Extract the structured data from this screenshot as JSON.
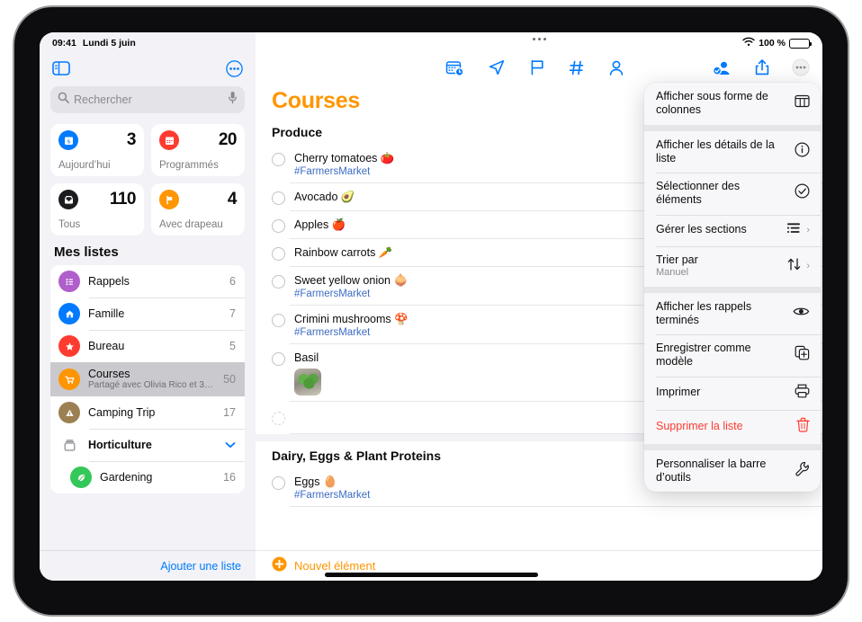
{
  "status_bar": {
    "time": "09:41",
    "date": "Lundi 5 juin",
    "battery_pct": "100 %"
  },
  "sidebar": {
    "toolbar": {
      "sidebar_toggle_icon": "sidebar-toggle-icon",
      "more_icon": "more-circle-icon"
    },
    "search": {
      "placeholder": "Rechercher",
      "value": "",
      "search_icon": "search-icon",
      "mic_icon": "microphone-icon"
    },
    "smart_lists": [
      {
        "label": "Aujourd’hui",
        "count": "3",
        "icon": "today-calendar-icon",
        "color": "#007aff"
      },
      {
        "label": "Programmés",
        "count": "20",
        "icon": "scheduled-calendar-icon",
        "color": "#ff3b30"
      },
      {
        "label": "Tous",
        "count": "110",
        "icon": "all-inbox-icon",
        "color": "#1c1c1e"
      },
      {
        "label": "Avec drapeau",
        "count": "4",
        "icon": "flag-icon",
        "color": "#ff9500"
      }
    ],
    "my_lists_header": "Mes listes",
    "lists": [
      {
        "name": "Rappels",
        "count": "6",
        "icon": "list-bullet-icon",
        "color": "#b05ecb",
        "subtitle": "",
        "selected": false,
        "type": "list"
      },
      {
        "name": "Famille",
        "count": "7",
        "icon": "house-icon",
        "color": "#007aff",
        "subtitle": "",
        "selected": false,
        "type": "list"
      },
      {
        "name": "Bureau",
        "count": "5",
        "icon": "star-icon",
        "color": "#ff3b30",
        "subtitle": "",
        "selected": false,
        "type": "list"
      },
      {
        "name": "Courses",
        "count": "50",
        "icon": "cart-icon",
        "color": "#ff9500",
        "subtitle": "Partagé avec Olivia Rico et 3…",
        "selected": true,
        "type": "list"
      },
      {
        "name": "Camping Trip",
        "count": "17",
        "icon": "triangle-exclamation-icon",
        "color": "#9c8052",
        "subtitle": "",
        "selected": false,
        "type": "list"
      },
      {
        "name": "Horticulture",
        "count": "",
        "icon": "folder-icon",
        "color": "#8e8e93",
        "subtitle": "",
        "selected": false,
        "type": "group"
      },
      {
        "name": "Gardening",
        "count": "16",
        "icon": "leaf-icon",
        "color": "#34c759",
        "subtitle": "",
        "selected": false,
        "type": "list"
      }
    ],
    "add_list_label": "Ajouter une liste"
  },
  "main": {
    "toolbar_icons": [
      {
        "name": "calendar-clock-icon"
      },
      {
        "name": "location-arrow-icon"
      },
      {
        "name": "flag-icon"
      },
      {
        "name": "hashtag-icon"
      },
      {
        "name": "person-icon"
      }
    ],
    "toolbar_right_icons": [
      {
        "name": "add-person-icon"
      },
      {
        "name": "share-icon"
      },
      {
        "name": "more-circle-icon"
      }
    ],
    "title": "Courses",
    "sections": [
      {
        "header": "Produce",
        "items": [
          {
            "title": "Cherry tomatoes 🍅",
            "tag": "#FarmersMarket",
            "photo": false
          },
          {
            "title": "Avocado 🥑",
            "tag": "",
            "photo": false
          },
          {
            "title": "Apples 🍎",
            "tag": "",
            "photo": false
          },
          {
            "title": "Rainbow carrots 🥕",
            "tag": "",
            "photo": false
          },
          {
            "title": "Sweet yellow onion 🧅",
            "tag": "#FarmersMarket",
            "photo": false
          },
          {
            "title": "Crimini mushrooms 🍄",
            "tag": "#FarmersMarket",
            "photo": false
          },
          {
            "title": "Basil",
            "tag": "",
            "photo": true
          },
          {
            "title": "",
            "tag": "",
            "photo": false
          }
        ]
      },
      {
        "header": "Dairy, Eggs & Plant Proteins",
        "items": [
          {
            "title": "Eggs 🥚",
            "tag": "#FarmersMarket",
            "photo": false
          }
        ]
      }
    ],
    "new_item_label": "Nouvel élément"
  },
  "context_menu": [
    {
      "label": "Afficher sous forme de colonnes",
      "sub": "",
      "icon": "columns-view-icon",
      "chevron": false,
      "destructive": false,
      "separator_after": true
    },
    {
      "label": "Afficher les détails de la liste",
      "sub": "",
      "icon": "info-circle-icon",
      "chevron": false,
      "destructive": false,
      "separator_after": false
    },
    {
      "label": "Sélectionner des éléments",
      "sub": "",
      "icon": "checkmark-circle-icon",
      "chevron": false,
      "destructive": false,
      "separator_after": false
    },
    {
      "label": "Gérer les sections",
      "sub": "",
      "icon": "sections-list-icon",
      "chevron": true,
      "destructive": false,
      "separator_after": false
    },
    {
      "label": "Trier par",
      "sub": "Manuel",
      "icon": "sort-arrows-icon",
      "chevron": true,
      "destructive": false,
      "separator_after": true
    },
    {
      "label": "Afficher les rappels terminés",
      "sub": "",
      "icon": "eye-icon",
      "chevron": false,
      "destructive": false,
      "separator_after": false
    },
    {
      "label": "Enregistrer comme modèle",
      "sub": "",
      "icon": "duplicate-plus-icon",
      "chevron": false,
      "destructive": false,
      "separator_after": false
    },
    {
      "label": "Imprimer",
      "sub": "",
      "icon": "printer-icon",
      "chevron": false,
      "destructive": false,
      "separator_after": false
    },
    {
      "label": "Supprimer la liste",
      "sub": "",
      "icon": "trash-icon",
      "chevron": false,
      "destructive": true,
      "separator_after": true
    },
    {
      "label": "Personnaliser la barre d’outils",
      "sub": "",
      "icon": "wrench-icon",
      "chevron": false,
      "destructive": false,
      "separator_after": false
    }
  ]
}
